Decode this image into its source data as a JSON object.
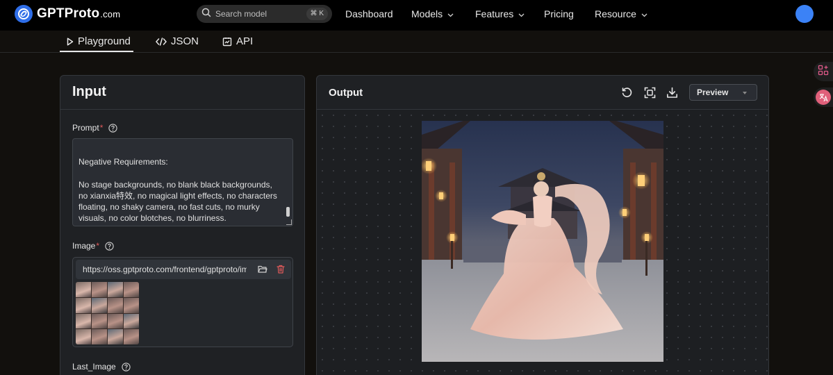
{
  "brand": {
    "name": "GPTProto",
    "suffix": ".com",
    "logo_icon": "gptproto-logo-icon"
  },
  "search": {
    "placeholder": "Search model",
    "shortcut": "⌘ K"
  },
  "nav": {
    "items": [
      {
        "label": "Dashboard",
        "has_dropdown": false
      },
      {
        "label": "Models",
        "has_dropdown": true
      },
      {
        "label": "Features",
        "has_dropdown": true
      },
      {
        "label": "Pricing",
        "has_dropdown": false
      },
      {
        "label": "Resource",
        "has_dropdown": true
      }
    ]
  },
  "tabs": [
    {
      "label": "Playground",
      "icon": "play-icon",
      "active": true
    },
    {
      "label": "JSON",
      "icon": "code-icon",
      "active": false
    },
    {
      "label": "API",
      "icon": "api-icon",
      "active": false
    }
  ],
  "input_panel": {
    "title": "Input",
    "prompt": {
      "label": "Prompt",
      "required_mark": "*",
      "text_line1": "Negative Requirements:",
      "text_line2": "No stage backgrounds, no blank black backgrounds, no xianxia特效, no magical light effects, no characters floating, no shaky camera, no fast cuts, no murky visuals, no color blotches, no blurriness."
    },
    "image": {
      "label": "Image",
      "required_mark": "*",
      "url": "https://oss.gptproto.com/frontend/gptproto/images/"
    },
    "last_image": {
      "label": "Last_Image"
    }
  },
  "output_panel": {
    "title": "Output",
    "view_mode": "Preview"
  },
  "colors": {
    "accent": "#3b82f6",
    "required": "#e05a5a",
    "panel_bg": "#1f2124",
    "page_bg": "#12100d"
  }
}
